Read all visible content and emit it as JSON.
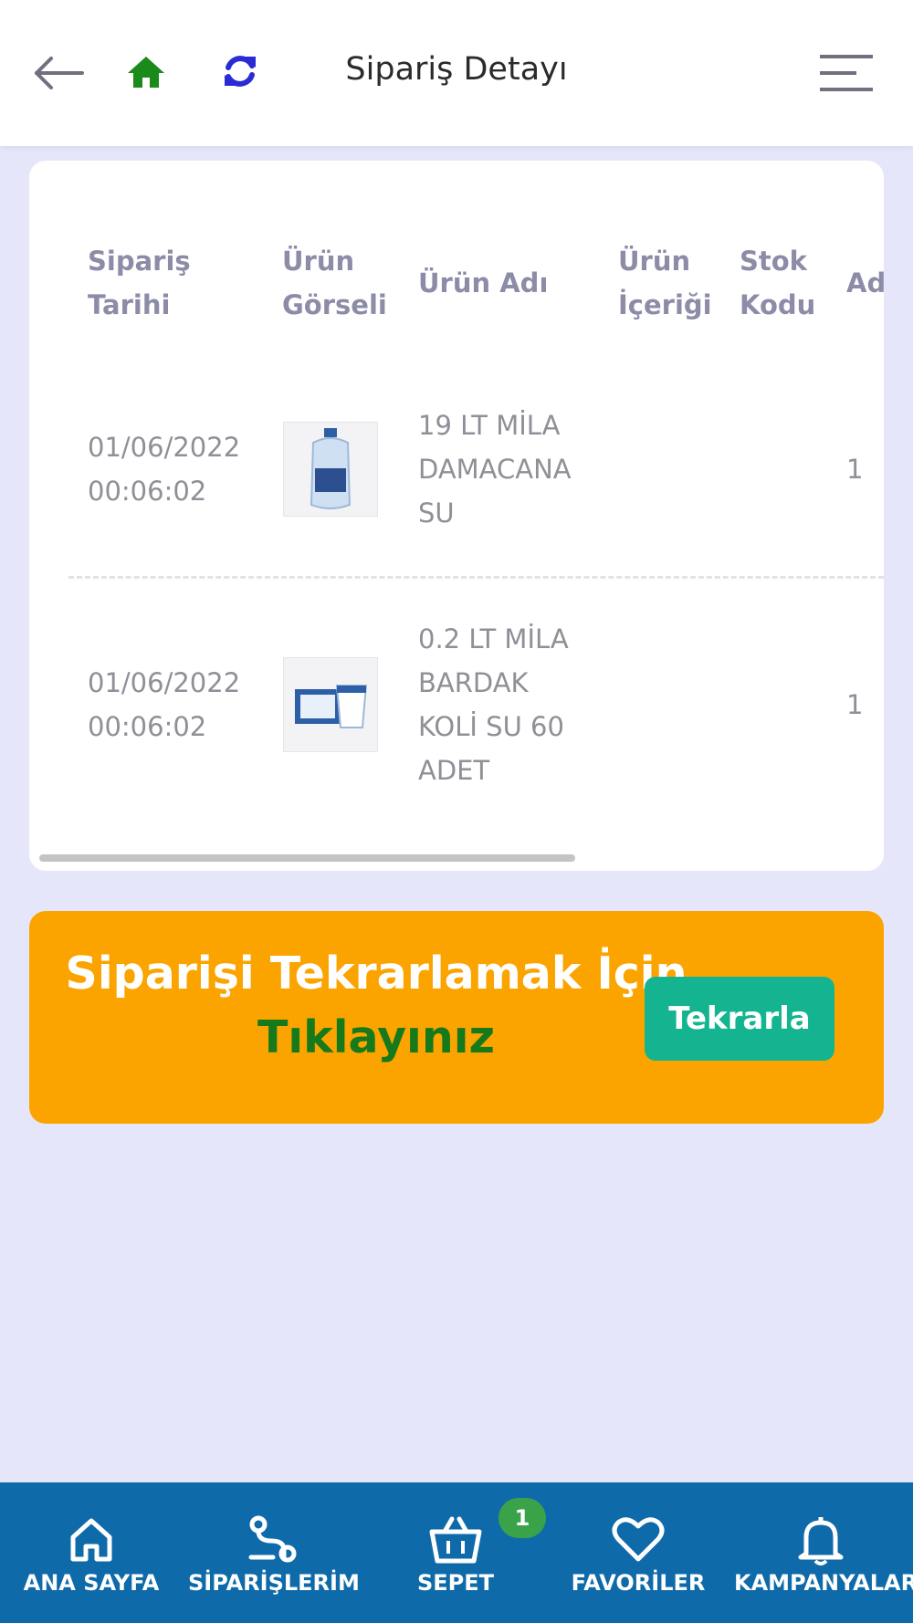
{
  "header": {
    "title": "Sipariş Detayı"
  },
  "table": {
    "columns": [
      "Sipariş\nTarihi",
      "Ürün\nGörseli",
      "Ürün Adı",
      "Ürün\nİçeriği",
      "Stok\nKodu",
      "Ad"
    ],
    "rows": [
      {
        "date": "01/06/2022\n00:06:02",
        "name": "19 LT MİLA\nDAMACANA\nSU",
        "content": "",
        "stock_code": "",
        "qty": "1"
      },
      {
        "date": "01/06/2022\n00:06:02",
        "name": "0.2 LT MİLA\nBARDAK\nKOLİ SU 60\nADET",
        "content": "",
        "stock_code": "",
        "qty": "1"
      }
    ]
  },
  "banner": {
    "line1": "Siparişi Tekrarlamak İçin",
    "line2": "Tıklayınız",
    "button": "Tekrarla"
  },
  "bottom_nav": {
    "items": [
      {
        "label": "ANA SAYFA"
      },
      {
        "label": "SİPARİŞLERİM"
      },
      {
        "label": "SEPET"
      },
      {
        "label": "FAVORİLER"
      },
      {
        "label": "KAMPANYALAR"
      }
    ],
    "cart_badge": "1"
  },
  "colors": {
    "background": "#e6e6fb",
    "banner": "#fba400",
    "banner_highlight": "#167a1b",
    "button": "#13b48f",
    "nav": "#0f6aaa",
    "home_icon": "#1a8a1a",
    "refresh_icon": "#2b2bd6"
  }
}
